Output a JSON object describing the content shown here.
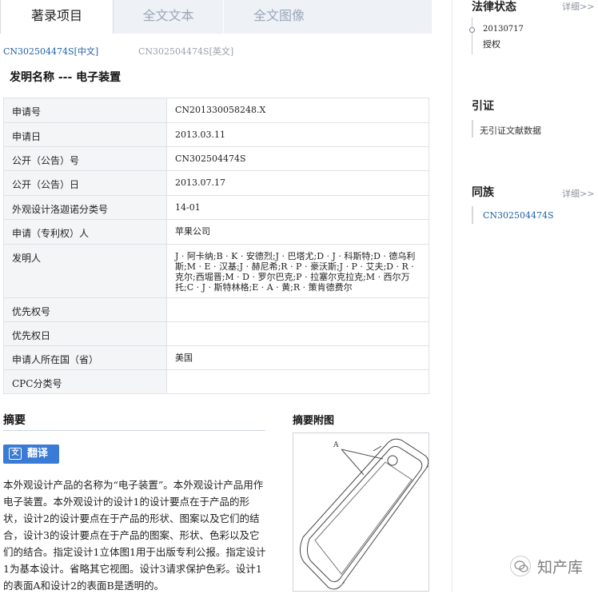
{
  "tabs": [
    "著录项目",
    "全文文本",
    "全文图像"
  ],
  "lang_links": [
    "CN302504474S[中文]",
    "CN302504474S[英文]"
  ],
  "invention_title": "发明名称 --- 电子装置",
  "table": [
    {
      "key": "申请号",
      "value": "CN201330058248.X"
    },
    {
      "key": "申请日",
      "value": "2013.03.11"
    },
    {
      "key": "公开（公告）号",
      "value": "CN302504474S"
    },
    {
      "key": "公开（公告）日",
      "value": "2013.07.17"
    },
    {
      "key": "外观设计洛迦诺分类号",
      "value": "14-01"
    },
    {
      "key": "申请（专利权）人",
      "value": "苹果公司"
    },
    {
      "key": "发明人",
      "value": "J · 阿卡纳;B · K · 安德烈;J · 巴塔尤;D · J · 科斯特;D · 德乌利斯;M · E · 汉基;J · 赫尼希;R · P · 豪沃斯;J · P · 艾夫;D · R · 克尔;西堀晋;M · D · 罗尔巴克;P · 拉塞尔克拉克;M · 西尔万托;C · J · 斯特林格;E · A · 黄;R · 策肯德费尔"
    },
    {
      "key": "优先权号",
      "value": ""
    },
    {
      "key": "优先权日",
      "value": ""
    },
    {
      "key": "申请人所在国（省）",
      "value": "美国"
    },
    {
      "key": "CPC分类号",
      "value": ""
    }
  ],
  "abstract": {
    "heading": "摘要",
    "translate_label": "翻译",
    "translate_icon": "文",
    "text": "本外观设计产品的名称为“电子装置”。本外观设计产品用作电子装置。本外观设计的设计1的设计要点在于产品的形状，设计2的设计要点在于产品的形状、图案以及它们的结合，设计3的设计要点在于产品的图案、形状、色彩以及它们的结合。指定设计1立体图1用于出版专利公报。指定设计1为基本设计。省略其它视图。设计3请求保护色彩。设计1的表面A和设计2的表面B是透明的。"
  },
  "figure": {
    "heading": "摘要附图",
    "label": "A"
  },
  "sidebar": {
    "legal": {
      "title": "法律状态",
      "more": "详细>>",
      "date": "20130717",
      "status": "授权"
    },
    "citation": {
      "title": "引证",
      "text": "无引证文献数据"
    },
    "family": {
      "title": "同族",
      "more": "详细>>",
      "item": "CN302504474S"
    }
  },
  "watermark": "知产库",
  "colors": {
    "link": "#1f5fa8",
    "button": "#3a7bd5",
    "tab_inactive_bg": "#eef1f6"
  }
}
